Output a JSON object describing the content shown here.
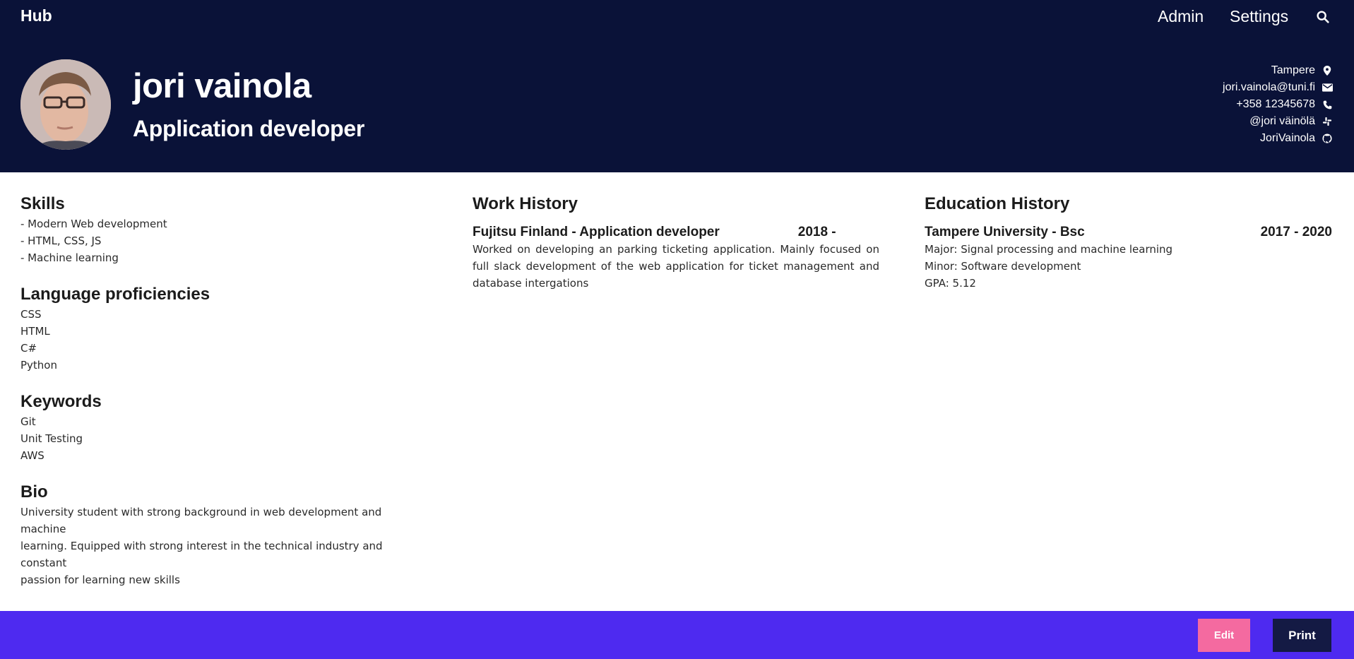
{
  "topbar": {
    "brand": "Hub",
    "nav": {
      "admin": "Admin",
      "settings": "Settings"
    },
    "search_icon": "search-icon"
  },
  "profile": {
    "name": "jori vainola",
    "title": "Application developer",
    "contacts": {
      "location": "Tampere",
      "email": "jori.vainola@tuni.fi",
      "phone": "+358 12345678",
      "slack": "@jori väinölä",
      "github": "JoriVainola"
    }
  },
  "skills": {
    "heading": "Skills",
    "items": [
      "- Modern Web development",
      "- HTML, CSS, JS",
      "- Machine learning"
    ]
  },
  "languages": {
    "heading": "Language proficiencies",
    "items": [
      "CSS",
      "HTML",
      "C#",
      "Python"
    ]
  },
  "keywords": {
    "heading": "Keywords",
    "items": [
      "Git",
      "Unit Testing",
      "AWS"
    ]
  },
  "bio": {
    "heading": "Bio",
    "lines": [
      "University student with strong background in web development and machine",
      "learning. Equipped with strong interest in the technical industry and constant",
      "passion for learning new skills"
    ]
  },
  "work": {
    "heading": "Work History",
    "entries": [
      {
        "title": "Fujitsu Finland - Application developer",
        "years": "2018 -",
        "description": "Worked on developing an parking ticketing application. Mainly focused on full slack development of the web application for ticket management and database intergations"
      }
    ]
  },
  "education": {
    "heading": "Education History",
    "entries": [
      {
        "title": "Tampere University - Bsc",
        "years": "2017 - 2020",
        "details": [
          "Major: Signal processing and machine learning",
          "Minor: Software development",
          "GPA: 5.12"
        ]
      }
    ]
  },
  "footer": {
    "edit_label": "Edit",
    "print_label": "Print"
  },
  "colors": {
    "header_bg": "#0a1238",
    "footer_bg": "#4e2af0",
    "edit_button": "#f46aa0",
    "print_button": "#141a44"
  }
}
